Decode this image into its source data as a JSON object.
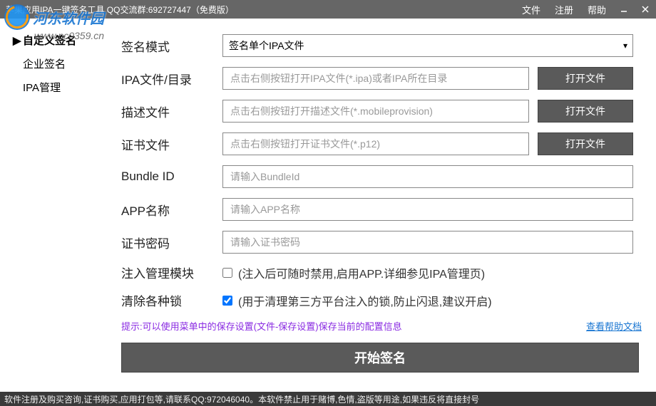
{
  "titlebar": {
    "title": "苹果应用IPA一键签名工具 QQ交流群:692727447（免费版）",
    "menu": {
      "file": "文件",
      "register": "注册",
      "help": "帮助"
    }
  },
  "watermark": {
    "text": "河东软件园",
    "url": "www.pc0359.cn"
  },
  "sidebar": {
    "items": [
      {
        "label": "自定义签名",
        "active": true
      },
      {
        "label": "企业签名",
        "active": false
      },
      {
        "label": "IPA管理",
        "active": false
      }
    ]
  },
  "form": {
    "sign_mode_label": "签名模式",
    "sign_mode_value": "签名单个IPA文件",
    "ipa_path_label": "IPA文件/目录",
    "ipa_path_placeholder": "点击右侧按钮打开IPA文件(*.ipa)或者IPA所在目录",
    "desc_file_label": "描述文件",
    "desc_file_placeholder": "点击右侧按钮打开描述文件(*.mobileprovision)",
    "cert_file_label": "证书文件",
    "cert_file_placeholder": "点击右侧按钮打开证书文件(*.p12)",
    "bundle_id_label": "Bundle ID",
    "bundle_id_placeholder": "请输入BundleId",
    "app_name_label": "APP名称",
    "app_name_placeholder": "请输入APP名称",
    "cert_pwd_label": "证书密码",
    "cert_pwd_placeholder": "请输入证书密码",
    "inject_label": "注入管理模块",
    "inject_desc": "(注入后可随时禁用,启用APP.详细参见IPA管理页)",
    "clear_label": "清除各种锁",
    "clear_desc": "(用于清理第三方平台注入的锁,防止闪退,建议开启)",
    "open_btn": "打开文件",
    "start_btn": "开始签名"
  },
  "tip": {
    "text": "提示:可以使用菜单中的保存设置(文件-保存设置)保存当前的配置信息",
    "help_link": "查看帮助文档"
  },
  "statusbar": "软件注册及购买咨询,证书购买,应用打包等,请联系QQ:972046040。本软件禁止用于赌博,色情,盗版等用途,如果违反将直接封号"
}
